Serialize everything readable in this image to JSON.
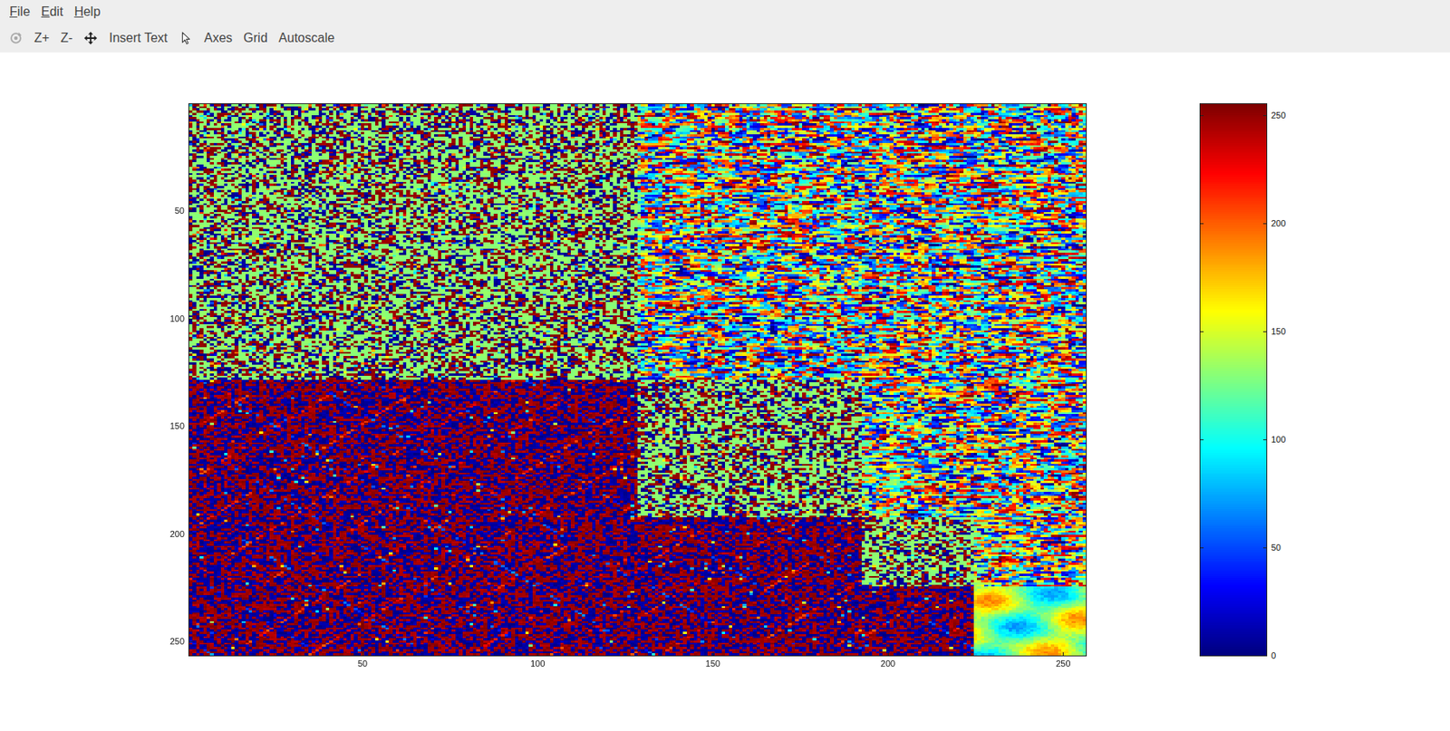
{
  "menu": [
    {
      "label": "File"
    },
    {
      "label": "Edit"
    },
    {
      "label": "Help"
    }
  ],
  "toolbar": [
    {
      "kind": "rotate",
      "label": "",
      "disabled": true
    },
    {
      "kind": "text",
      "label": "Z+",
      "disabled": false
    },
    {
      "kind": "text",
      "label": "Z-",
      "disabled": false
    },
    {
      "kind": "pan",
      "label": "",
      "disabled": false
    },
    {
      "kind": "text",
      "label": "Insert Text",
      "disabled": false
    },
    {
      "kind": "pointer",
      "label": "",
      "disabled": false
    },
    {
      "kind": "text",
      "label": "Axes",
      "disabled": false
    },
    {
      "kind": "text",
      "label": "Grid",
      "disabled": false
    },
    {
      "kind": "text",
      "label": "Autoscale",
      "disabled": false
    }
  ],
  "heatmap": {
    "rows": 256,
    "cols": 256,
    "min": 0,
    "max": 255,
    "x_ticks": [
      "50",
      "100",
      "150",
      "200",
      "250"
    ],
    "y_ticks": [
      "50",
      "100",
      "150",
      "200",
      "250"
    ],
    "regions": [
      {
        "rows": [
          1,
          128
        ],
        "cols": [
          1,
          128
        ],
        "kind": "mixed"
      },
      {
        "rows": [
          1,
          128
        ],
        "cols": [
          129,
          256
        ],
        "kind": "noise"
      },
      {
        "rows": [
          129,
          256
        ],
        "cols": [
          1,
          128
        ],
        "kind": "binary"
      },
      {
        "rows": [
          129,
          192
        ],
        "cols": [
          129,
          192
        ],
        "kind": "mixed"
      },
      {
        "rows": [
          129,
          192
        ],
        "cols": [
          193,
          256
        ],
        "kind": "noise"
      },
      {
        "rows": [
          193,
          256
        ],
        "cols": [
          129,
          192
        ],
        "kind": "binary"
      },
      {
        "rows": [
          193,
          224
        ],
        "cols": [
          193,
          224
        ],
        "kind": "mixed"
      },
      {
        "rows": [
          193,
          224
        ],
        "cols": [
          225,
          256
        ],
        "kind": "noise"
      },
      {
        "rows": [
          225,
          256
        ],
        "cols": [
          193,
          224
        ],
        "kind": "binary"
      },
      {
        "rows": [
          225,
          256
        ],
        "cols": [
          225,
          256
        ],
        "kind": "smooth"
      }
    ]
  },
  "colorbar": {
    "min": 0,
    "max": 255,
    "ticks": [
      "0",
      "50",
      "100",
      "150",
      "200",
      "250"
    ]
  }
}
